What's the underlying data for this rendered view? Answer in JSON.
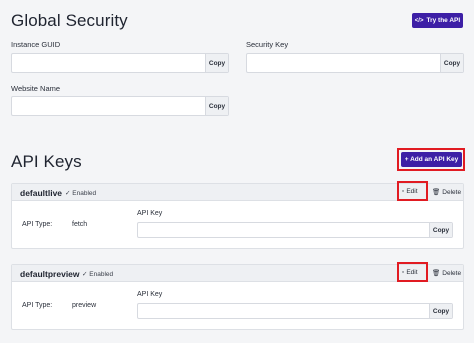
{
  "global": {
    "title": "Global Security",
    "try_api_label": "Try the API",
    "instance_guid_label": "Instance GUID",
    "security_key_label": "Security Key",
    "website_name_label": "Website Name",
    "copy_label": "Copy"
  },
  "api_keys": {
    "title": "API Keys",
    "add_label": "+ Add an API Key",
    "api_type_label": "API Type:",
    "api_key_label": "API Key",
    "edit_label": "Edit",
    "delete_label": "Delete",
    "copy_label": "Copy",
    "items": [
      {
        "name": "defaultlive",
        "status": "Enabled",
        "type": "fetch"
      },
      {
        "name": "defaultpreview",
        "status": "Enabled",
        "type": "preview"
      }
    ]
  },
  "colors": {
    "accent": "#3d1fa6",
    "highlight": "#e11b22"
  }
}
